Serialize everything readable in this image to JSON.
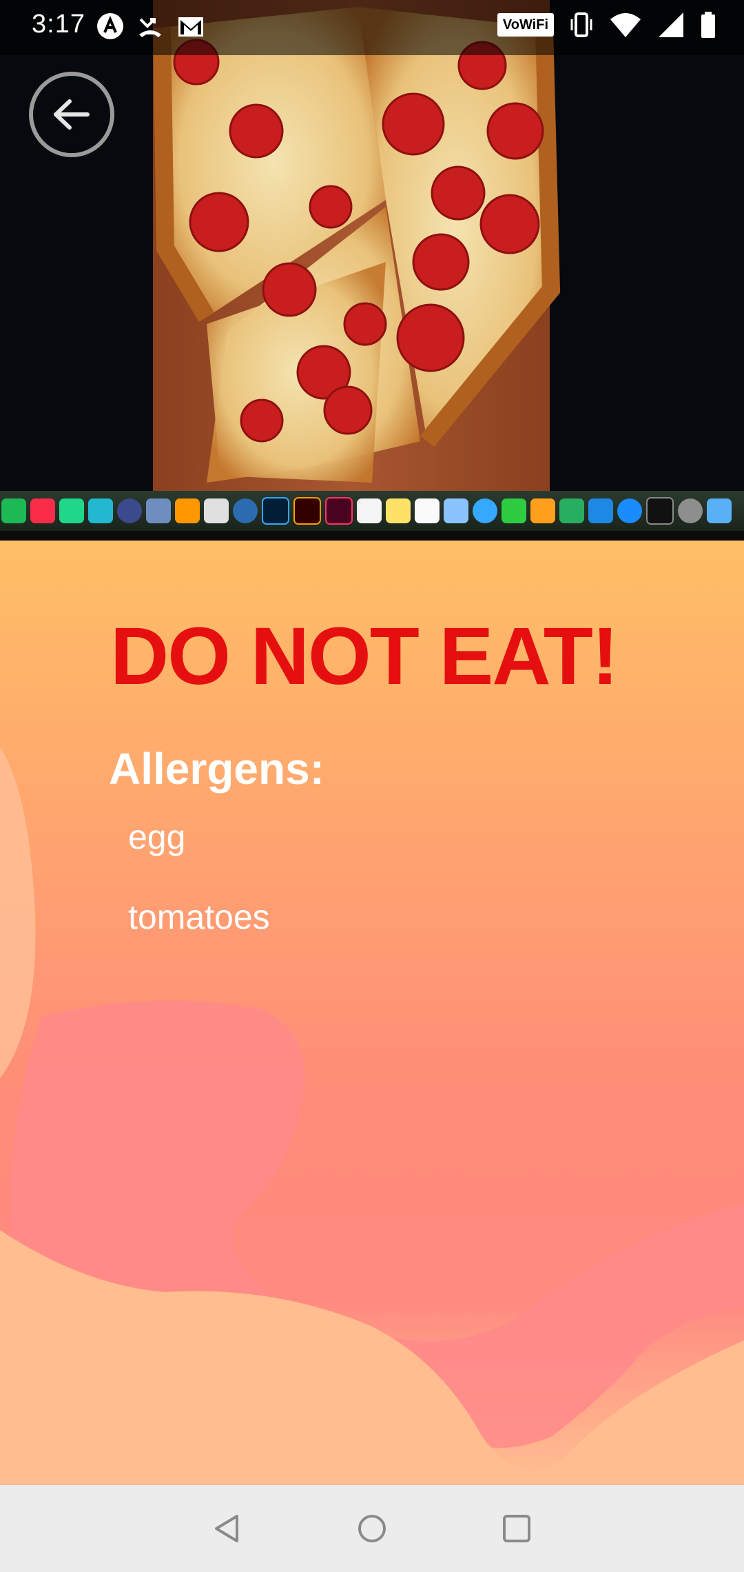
{
  "status_bar": {
    "time": "3:17",
    "left_icons": [
      "app-logo-icon",
      "missed-call-icon",
      "gmail-icon"
    ],
    "vowifi_label": "VoWiFi",
    "right_icons": [
      "vibrate-icon",
      "wifi-icon",
      "cellular-signal-icon",
      "battery-icon"
    ]
  },
  "photo": {
    "subject": "pepperoni pizza on wooden board",
    "dock_apps": [
      "spotify",
      "music",
      "pycharm",
      "clion",
      "eclipse",
      "virtualbox",
      "sublime",
      "unity",
      "r",
      "photoshop",
      "illustrator",
      "indesign",
      "calendar",
      "notes",
      "textedit",
      "preview",
      "messages",
      "facetime",
      "pages",
      "numbers",
      "keynote",
      "app-store",
      "terminal",
      "system-preferences",
      "finder"
    ]
  },
  "info": {
    "warning_title": "DO NOT EAT!",
    "allergens_heading": "Allergens:",
    "allergens": [
      "egg",
      "tomatoes"
    ]
  },
  "colors": {
    "warning": "#e60f0f",
    "panel_top": "#ffbf66",
    "panel_mid": "#ff8b78",
    "nav_bar": "#ececec"
  }
}
